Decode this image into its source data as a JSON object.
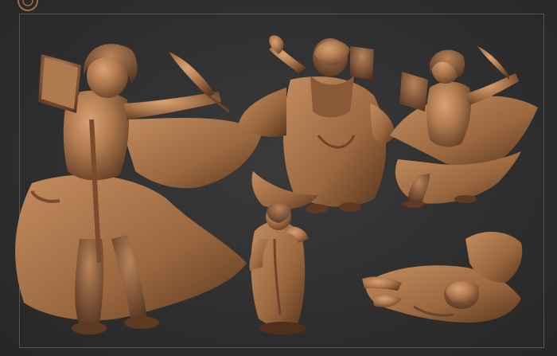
{
  "scene": {
    "background": "#2b2b2b",
    "frame_color": "#555555",
    "clay_color": "#b07a4f",
    "clay_shadow": "#6e4429",
    "clay_highlight": "#d29b6a"
  },
  "logo": {
    "icon": "circle-badge-icon",
    "color": "#a06a45"
  },
  "figures": [
    {
      "name": "mage-front-large",
      "pose": "front"
    },
    {
      "name": "mage-back-view",
      "pose": "back"
    },
    {
      "name": "mage-front-small",
      "pose": "front"
    },
    {
      "name": "mage-side-view",
      "pose": "side"
    },
    {
      "name": "mage-top-view",
      "pose": "top"
    }
  ]
}
